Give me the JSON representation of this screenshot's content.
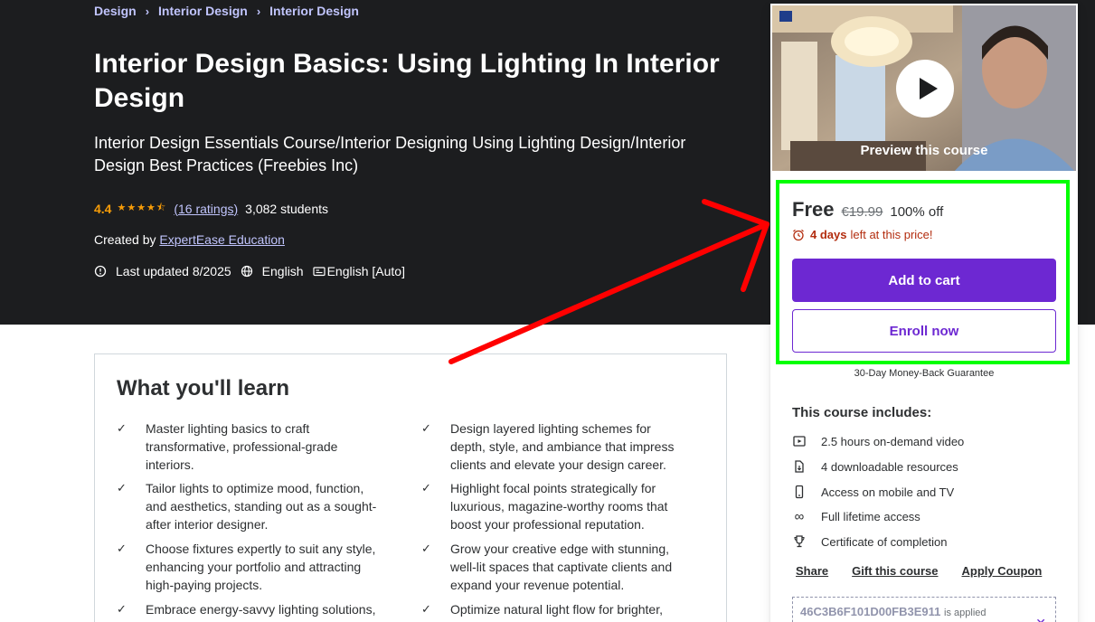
{
  "breadcrumb": [
    "Design",
    "Interior Design",
    "Interior Design"
  ],
  "course": {
    "title": "Interior Design Basics: Using Lighting In Interior Design",
    "subtitle": "Interior Design Essentials Course/Interior Designing Using Lighting Design/Interior Design Best Practices (Freebies Inc)",
    "rating": "4.4",
    "stars": "★★★★⯪",
    "ratings_text": "(16 ratings)",
    "students": "3,082 students",
    "created_by_label": "Created by",
    "instructor": "ExpertEase Education",
    "last_updated": "Last updated 8/2025",
    "language": "English",
    "captions": "English [Auto]"
  },
  "learn": {
    "heading": "What you'll learn",
    "items": [
      "Master lighting basics to craft transformative, professional-grade interiors.",
      "Design layered lighting schemes for depth, style, and ambiance that impress clients and elevate your design career.",
      "Tailor lights to optimize mood, function, and aesthetics, standing out as a sought-after interior designer.",
      "Highlight focal points strategically for luxurious, magazine-worthy rooms that boost your professional reputation.",
      "Choose fixtures expertly to suit any style, enhancing your portfolio and attracting high-paying projects.",
      "Grow your creative edge with stunning, well-lit spaces that captivate clients and expand your revenue potential.",
      "Embrace energy-savvy lighting solutions,",
      "Optimize natural light flow for brighter, more"
    ]
  },
  "sidebar": {
    "preview_label": "Preview this course",
    "price": "Free",
    "old_price": "€19.99",
    "discount": "100% off",
    "timer_bold": "4 days",
    "timer_rest": "left at this price!",
    "add_to_cart": "Add to cart",
    "enroll_now": "Enroll now",
    "guarantee": "30-Day Money-Back Guarantee",
    "includes_title": "This course includes:",
    "includes": [
      "2.5 hours on-demand video",
      "4 downloadable resources",
      "Access on mobile and TV",
      "Full lifetime access",
      "Certificate of completion"
    ],
    "links": [
      "Share",
      "Gift this course",
      "Apply Coupon"
    ],
    "coupon_code": "46C3B6F101D00FB3E911",
    "coupon_status": "is applied"
  },
  "colors": {
    "hero_bg": "#1c1d1f",
    "accent": "#6d28d2",
    "highlight": "#00ff00",
    "arrow": "#ff0000",
    "rating": "#f69c08"
  }
}
